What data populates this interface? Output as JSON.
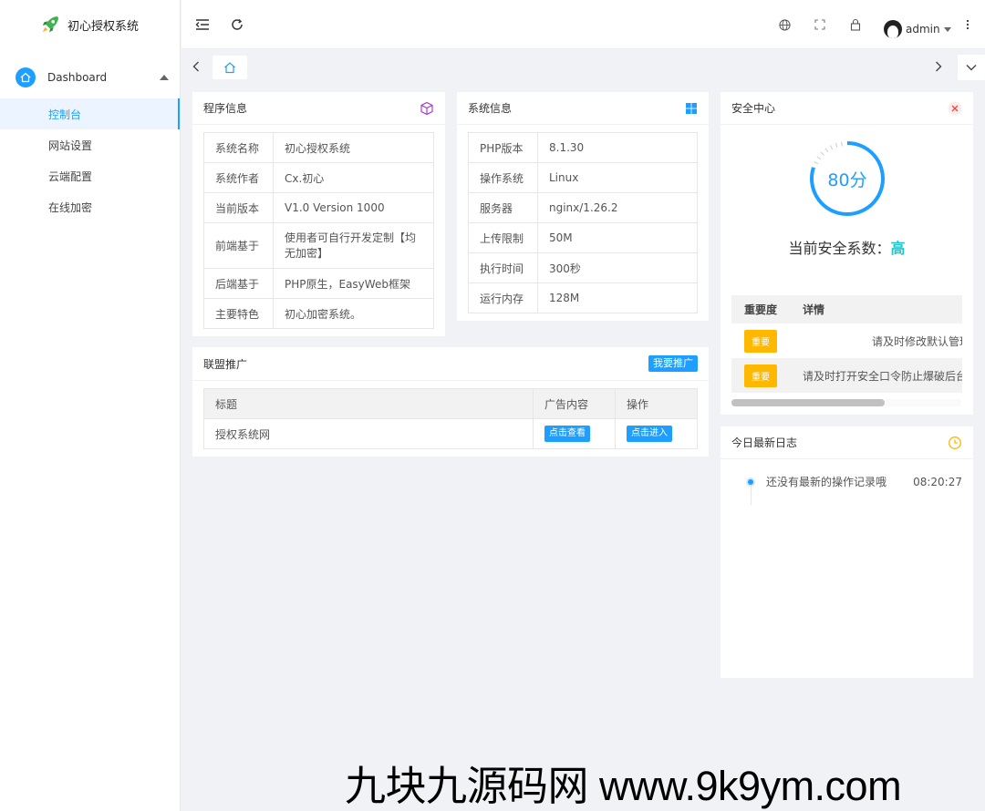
{
  "app": {
    "title": "初心授权系统"
  },
  "sidebar": {
    "parent": {
      "label": "Dashboard"
    },
    "items": [
      {
        "label": "控制台",
        "active": true
      },
      {
        "label": "网站设置"
      },
      {
        "label": "云端配置"
      },
      {
        "label": "在线加密"
      }
    ]
  },
  "header": {
    "user": "admin"
  },
  "program_info": {
    "title": "程序信息",
    "rows": [
      {
        "k": "系统名称",
        "v": "初心授权系统"
      },
      {
        "k": "系统作者",
        "v": "Cx.初心"
      },
      {
        "k": "当前版本",
        "v": "V1.0 Version 1000"
      },
      {
        "k": "前端基于",
        "v": "使用者可自行开发定制【均无加密】"
      },
      {
        "k": "后端基于",
        "v": "PHP原生，EasyWeb框架"
      },
      {
        "k": "主要特色",
        "v": "初心加密系统。"
      }
    ]
  },
  "system_info": {
    "title": "系统信息",
    "rows": [
      {
        "k": "PHP版本",
        "v": "8.1.30"
      },
      {
        "k": "操作系统",
        "v": "Linux"
      },
      {
        "k": "服务器",
        "v": "nginx/1.26.2"
      },
      {
        "k": "上传限制",
        "v": "50M"
      },
      {
        "k": "执行时间",
        "v": "300秒"
      },
      {
        "k": "运行内存",
        "v": "128M"
      }
    ]
  },
  "alliance": {
    "title": "联盟推广",
    "promote_button": "我要推广",
    "columns": [
      "标题",
      "广告内容",
      "操作"
    ],
    "rows": [
      {
        "title": "授权系统网",
        "view_button": "点击查看",
        "enter_button": "点击进入"
      }
    ]
  },
  "security": {
    "title": "安全中心",
    "score": 80,
    "score_text": "80分",
    "level_label": "当前安全系数：",
    "level": "高",
    "columns": [
      "重要度",
      "详情"
    ],
    "items": [
      {
        "level": "重要",
        "detail": "请及时修改默认管理员密"
      },
      {
        "level": "重要",
        "detail": "请及时打开安全口令防止爆破后台"
      }
    ],
    "accent": "#1e9fff",
    "level_color": "#22c3c9",
    "tag_color": "#ffb800"
  },
  "log": {
    "title": "今日最新日志",
    "entries": [
      {
        "text": "还没有最新的操作记录哦",
        "time": "08:20:27"
      }
    ]
  },
  "watermark": "九块九源码网 www.9k9ym.com"
}
